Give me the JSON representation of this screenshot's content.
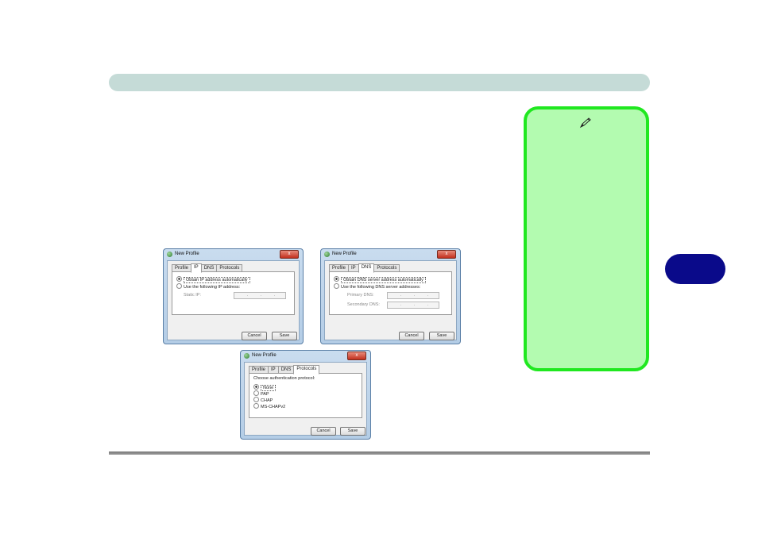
{
  "dialogs": {
    "ip": {
      "title": "New Profile",
      "close": "x",
      "tabs": [
        "Profile",
        "IP",
        "DNS",
        "Protocols"
      ],
      "option_auto": "Obtain IP address automatically",
      "option_manual": "Use the following IP address:",
      "static_ip_label": "Static IP:",
      "cancel": "Cancel",
      "save": "Save"
    },
    "dns": {
      "title": "New Profile",
      "close": "x",
      "tabs": [
        "Profile",
        "IP",
        "DNS",
        "Protocols"
      ],
      "option_auto": "Obtain DNS server address automatically",
      "option_manual": "Use the following DNS server addresses:",
      "primary_label": "Primary DNS:",
      "secondary_label": "Secondary DNS:",
      "cancel": "Cancel",
      "save": "Save"
    },
    "protocols": {
      "title": "New Profile",
      "close": "x",
      "tabs": [
        "Profile",
        "IP",
        "DNS",
        "Protocols"
      ],
      "prompt": "Choose authentication protocol:",
      "options": [
        "None",
        "PAP",
        "CHAP",
        "MS-CHAPv2"
      ],
      "cancel": "Cancel",
      "save": "Save"
    }
  },
  "colors": {
    "header_bar": "#c5dbd7",
    "note_fill": "#b3fbb0",
    "note_border": "#20e820",
    "chapter_tab": "#0a0a8a"
  },
  "icons": {
    "note": "pencil-icon",
    "title": "network-icon"
  }
}
